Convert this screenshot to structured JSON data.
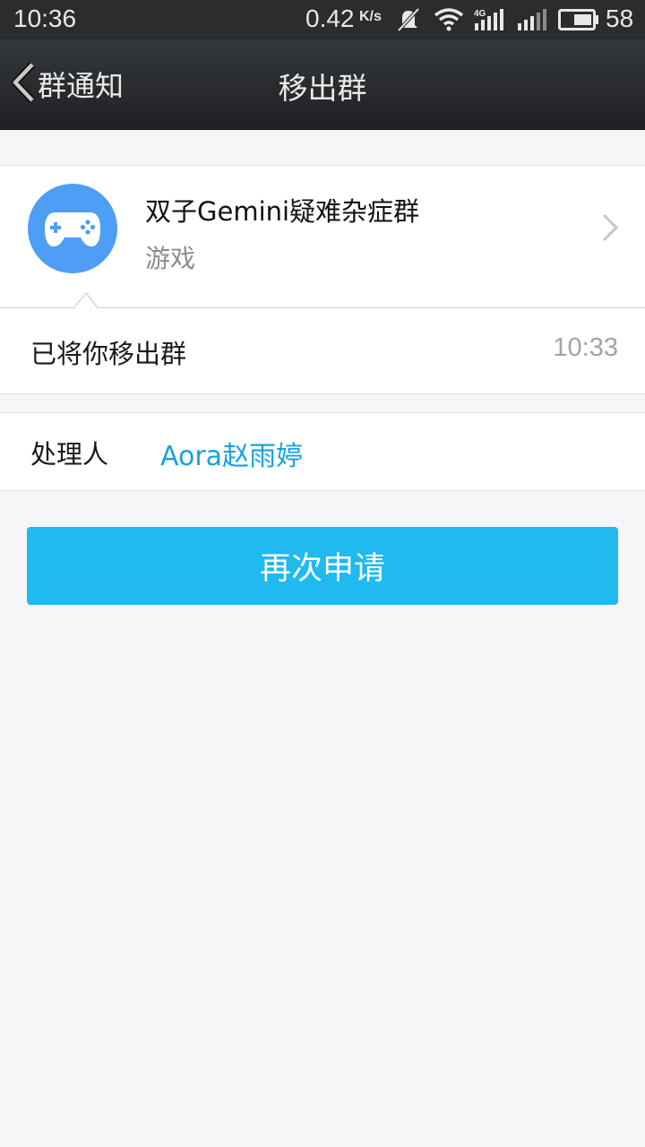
{
  "status_bar": {
    "time": "10:36",
    "net_speed": "0.42",
    "net_speed_unit": "K/s",
    "network_type": "4G",
    "battery": "58"
  },
  "nav": {
    "back_label": "群通知",
    "title": "移出群"
  },
  "group": {
    "name": "双子Gemini疑难杂症群",
    "category": "游戏",
    "avatar_color": "#4e9ef5"
  },
  "notice": {
    "text": "已将你移出群",
    "time": "10:33"
  },
  "handler": {
    "label": "处理人",
    "name": "Aora赵雨婷"
  },
  "actions": {
    "reapply_label": "再次申请"
  },
  "colors": {
    "accent": "#20b9f0",
    "link": "#17a3dc",
    "background": "#f6f6f8"
  }
}
